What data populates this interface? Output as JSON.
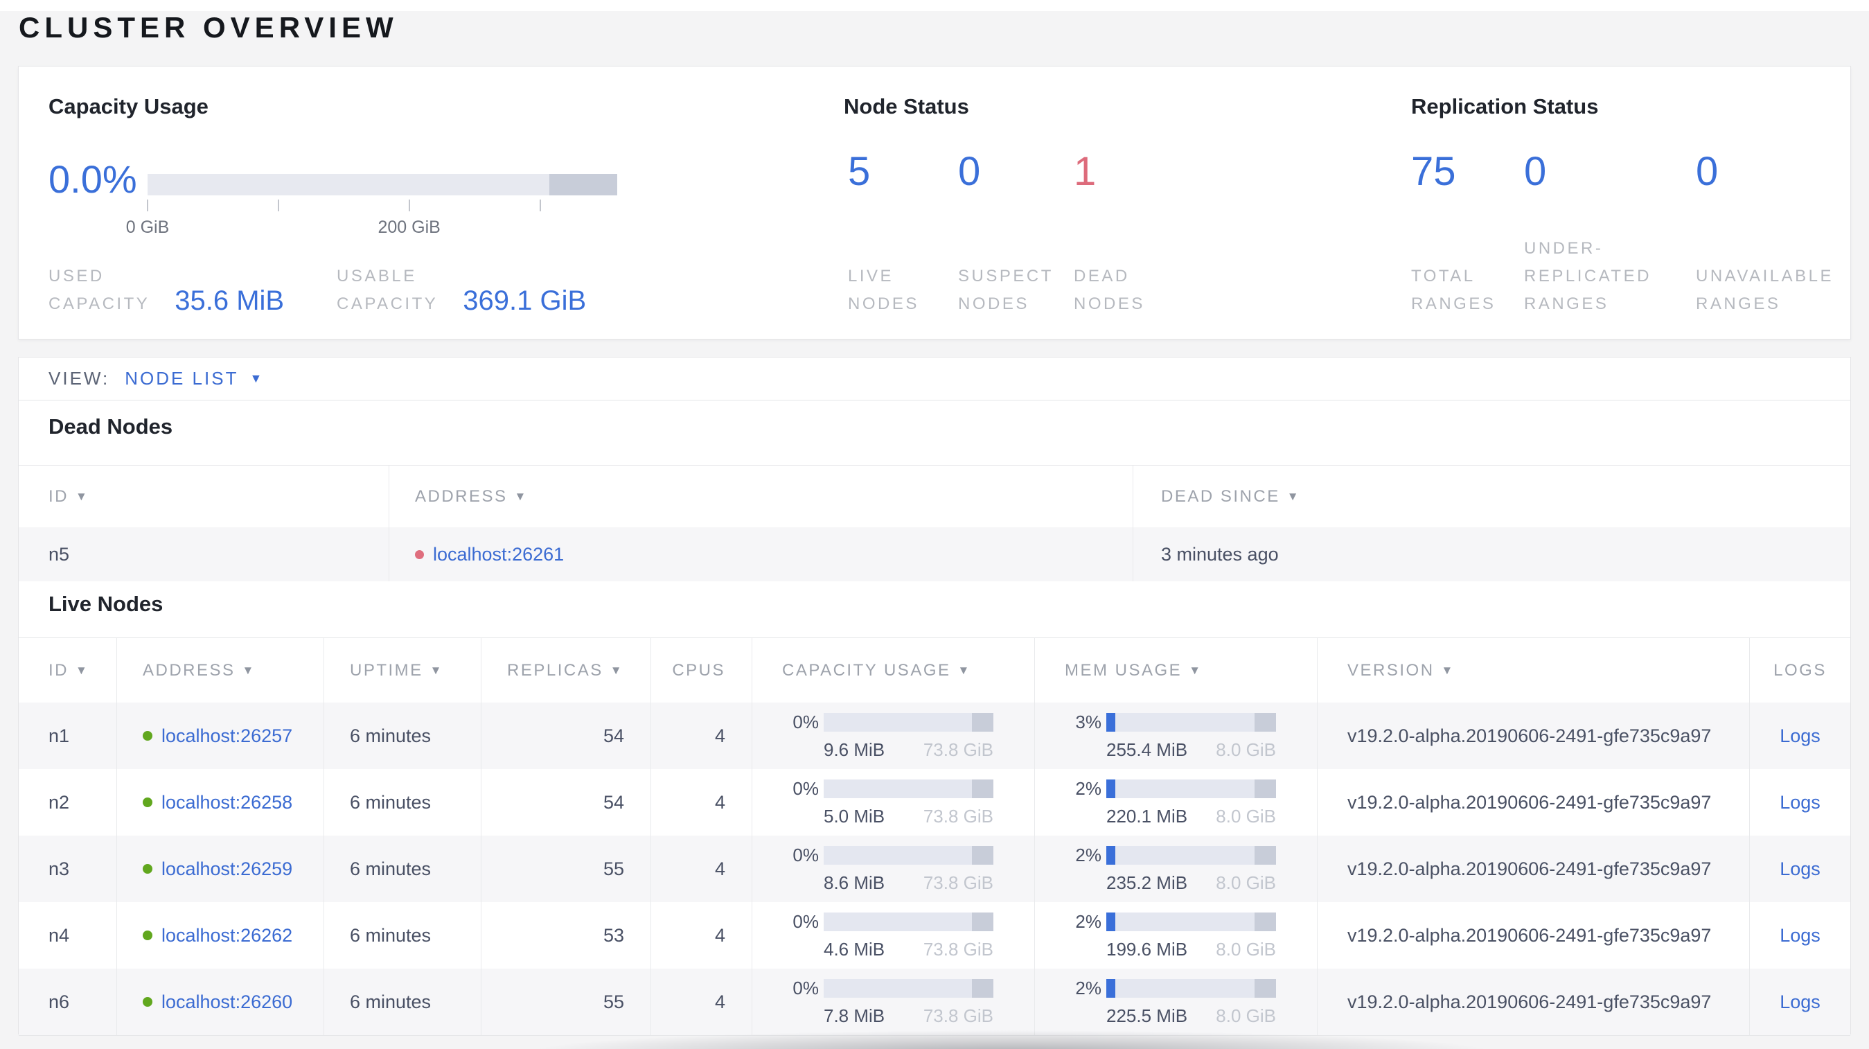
{
  "page_title": "CLUSTER OVERVIEW",
  "colors": {
    "accent_blue": "#3a6fd9",
    "link_blue": "#3b6bd2",
    "danger_red": "#dd6b7b",
    "live_green": "#61a71e",
    "dead_red": "#df6e7e",
    "label_gray": "#b6b9bf",
    "bar_track": "#e4e7f0",
    "bar_reserved": "#c8cdd9"
  },
  "summary": {
    "capacity": {
      "title": "Capacity Usage",
      "percent": "0.0%",
      "bar": {
        "used_pct": 0,
        "reserved_from_pct": 85.5,
        "ticks": [
          {
            "label": "0 GiB",
            "pos": 0
          },
          {
            "label": "",
            "pos": 27.9
          },
          {
            "label": "200 GiB",
            "pos": 55.7
          },
          {
            "label": "",
            "pos": 83.6
          }
        ]
      },
      "stats": [
        {
          "label_lines": [
            "USED",
            "CAPACITY"
          ],
          "value": "35.6 MiB"
        },
        {
          "label_lines": [
            "USABLE",
            "CAPACITY"
          ],
          "value": "369.1 GiB"
        }
      ]
    },
    "node_status": {
      "title": "Node Status",
      "stats": [
        {
          "value": "5",
          "label_lines": [
            "LIVE",
            "NODES"
          ],
          "tone": "blue"
        },
        {
          "value": "0",
          "label_lines": [
            "SUSPECT",
            "NODES"
          ],
          "tone": "blue"
        },
        {
          "value": "1",
          "label_lines": [
            "DEAD",
            "NODES"
          ],
          "tone": "red"
        }
      ]
    },
    "replication": {
      "title": "Replication Status",
      "stats": [
        {
          "value": "75",
          "label_lines": [
            "TOTAL",
            "RANGES"
          ],
          "tone": "blue"
        },
        {
          "value": "0",
          "label_lines": [
            "UNDER-",
            "REPLICATED",
            "RANGES"
          ],
          "tone": "blue"
        },
        {
          "value": "0",
          "label_lines": [
            "UNAVAILABLE",
            "RANGES"
          ],
          "tone": "blue"
        }
      ]
    }
  },
  "view_bar": {
    "label": "VIEW:",
    "selected": "NODE LIST"
  },
  "dead_nodes": {
    "heading": "Dead Nodes",
    "columns": [
      {
        "label": "ID",
        "sortable": true
      },
      {
        "label": "ADDRESS",
        "sortable": true
      },
      {
        "label": "DEAD SINCE",
        "sortable": true
      }
    ],
    "rows": [
      {
        "id": "n5",
        "address": "localhost:26261",
        "dead_since": "3 minutes ago"
      }
    ]
  },
  "live_nodes": {
    "heading": "Live Nodes",
    "columns": [
      {
        "label": "ID",
        "sortable": true
      },
      {
        "label": "ADDRESS",
        "sortable": true
      },
      {
        "label": "UPTIME",
        "sortable": true
      },
      {
        "label": "REPLICAS",
        "sortable": true
      },
      {
        "label": "CPUS",
        "sortable": false
      },
      {
        "label": "CAPACITY USAGE",
        "sortable": true
      },
      {
        "label": "MEM USAGE",
        "sortable": true
      },
      {
        "label": "VERSION",
        "sortable": true
      },
      {
        "label": "LOGS",
        "sortable": false
      }
    ],
    "logs_label": "Logs",
    "rows": [
      {
        "id": "n1",
        "address": "localhost:26257",
        "uptime": "6 minutes",
        "replicas": "54",
        "cpus": "4",
        "capacity": {
          "pct_label": "0%",
          "pct": 0,
          "used": "9.6 MiB",
          "total": "73.8 GiB"
        },
        "memory": {
          "pct_label": "3%",
          "pct": 3,
          "used": "255.4 MiB",
          "total": "8.0 GiB"
        },
        "version": "v19.2.0-alpha.20190606-2491-gfe735c9a97"
      },
      {
        "id": "n2",
        "address": "localhost:26258",
        "uptime": "6 minutes",
        "replicas": "54",
        "cpus": "4",
        "capacity": {
          "pct_label": "0%",
          "pct": 0,
          "used": "5.0 MiB",
          "total": "73.8 GiB"
        },
        "memory": {
          "pct_label": "2%",
          "pct": 2,
          "used": "220.1 MiB",
          "total": "8.0 GiB"
        },
        "version": "v19.2.0-alpha.20190606-2491-gfe735c9a97"
      },
      {
        "id": "n3",
        "address": "localhost:26259",
        "uptime": "6 minutes",
        "replicas": "55",
        "cpus": "4",
        "capacity": {
          "pct_label": "0%",
          "pct": 0,
          "used": "8.6 MiB",
          "total": "73.8 GiB"
        },
        "memory": {
          "pct_label": "2%",
          "pct": 2,
          "used": "235.2 MiB",
          "total": "8.0 GiB"
        },
        "version": "v19.2.0-alpha.20190606-2491-gfe735c9a97"
      },
      {
        "id": "n4",
        "address": "localhost:26262",
        "uptime": "6 minutes",
        "replicas": "53",
        "cpus": "4",
        "capacity": {
          "pct_label": "0%",
          "pct": 0,
          "used": "4.6 MiB",
          "total": "73.8 GiB"
        },
        "memory": {
          "pct_label": "2%",
          "pct": 2,
          "used": "199.6 MiB",
          "total": "8.0 GiB"
        },
        "version": "v19.2.0-alpha.20190606-2491-gfe735c9a97"
      },
      {
        "id": "n6",
        "address": "localhost:26260",
        "uptime": "6 minutes",
        "replicas": "55",
        "cpus": "4",
        "capacity": {
          "pct_label": "0%",
          "pct": 0,
          "used": "7.8 MiB",
          "total": "73.8 GiB"
        },
        "memory": {
          "pct_label": "2%",
          "pct": 2,
          "used": "225.5 MiB",
          "total": "8.0 GiB"
        },
        "version": "v19.2.0-alpha.20190606-2491-gfe735c9a97"
      }
    ]
  }
}
